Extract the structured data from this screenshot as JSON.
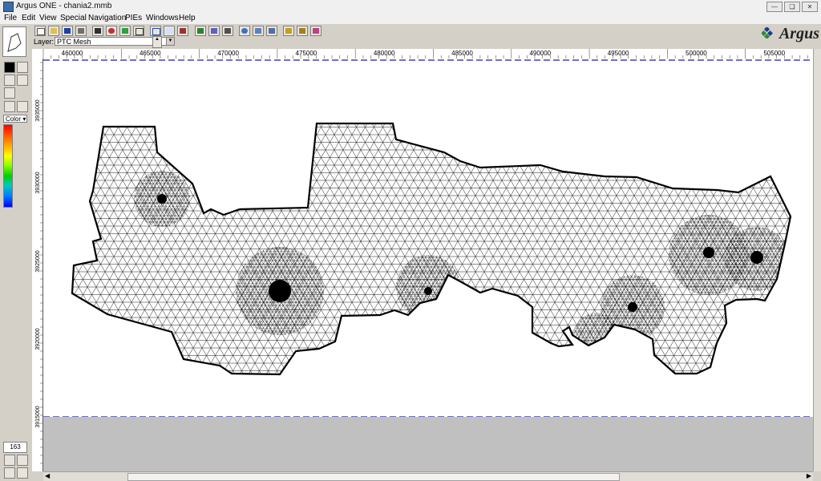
{
  "window": {
    "title": "Argus ONE - chania2.mmb"
  },
  "menu": [
    "File",
    "Edit",
    "View",
    "Special",
    "Navigation",
    "PIEs",
    "Windows",
    "Help"
  ],
  "toolbar": {
    "layer_label": "Layer:",
    "layer_value": "PTC Mesh",
    "logo": "Argus"
  },
  "palette": {
    "color_label": "Color",
    "zoom_value": "163"
  },
  "ruler": {
    "x_ticks": [
      "460000",
      "465000",
      "470000",
      "475000",
      "480000",
      "485000",
      "490000",
      "495000",
      "500000",
      "505000"
    ],
    "y_ticks": [
      "3935000",
      "3930000",
      "3925000",
      "3920000",
      "3915000"
    ]
  },
  "colors": {
    "mesh_line": "#000000",
    "boundary": "#000000",
    "canvas": "#ffffff",
    "limit_line": "#1a1aa0"
  }
}
